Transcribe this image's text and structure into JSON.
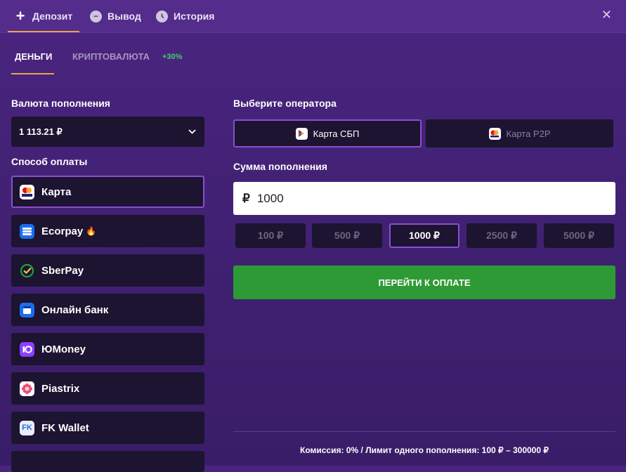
{
  "topbar": {
    "tabs": [
      {
        "label": "Депозит",
        "icon": "plus-icon"
      },
      {
        "label": "Вывод",
        "icon": "minus-circle-icon"
      },
      {
        "label": "История",
        "icon": "clock-icon"
      }
    ],
    "close_icon": "close-icon"
  },
  "subtabs": {
    "money": "ДЕНЬГИ",
    "crypto": "КРИПТОВАЛЮТА",
    "crypto_bonus": "+30%"
  },
  "left": {
    "currency_label": "Валюта пополнения",
    "currency_value": "1 113.21 ₽",
    "method_label": "Способ оплаты",
    "methods": [
      {
        "label": "Карта",
        "icon": "card-visa-mastercard-icon"
      },
      {
        "label": "Ecorpay",
        "icon": "ecorpay-icon",
        "extra": "🔥"
      },
      {
        "label": "SberPay",
        "icon": "sberpay-icon"
      },
      {
        "label": "Онлайн банк",
        "icon": "online-bank-icon"
      },
      {
        "label": "ЮMoney",
        "icon": "yumoney-icon"
      },
      {
        "label": "Piastrix",
        "icon": "piastrix-icon"
      },
      {
        "label": "FK Wallet",
        "icon": "fk-wallet-icon"
      }
    ]
  },
  "right": {
    "operator_label": "Выберите оператора",
    "operators": [
      {
        "label": "Карта СБП",
        "icon": "sbp-icon"
      },
      {
        "label": "Карта P2P",
        "icon": "mastercard-icon"
      }
    ],
    "amount_label": "Сумма пополнения",
    "amount_currency": "₽",
    "amount_value": "1000",
    "presets": [
      "100 ₽",
      "500 ₽",
      "1000 ₽",
      "2500 ₽",
      "5000 ₽"
    ],
    "pay_button": "ПЕРЕЙТИ К ОПЛАТЕ",
    "footer": "Комиссия: 0% / Лимит одного пополнения:  100 ₽ – 300000 ₽"
  },
  "colors": {
    "accent": "#e9a54a",
    "selected_border": "#8a4fd0",
    "pay_green": "#2e9a35",
    "bonus_green": "#3dd16a"
  }
}
